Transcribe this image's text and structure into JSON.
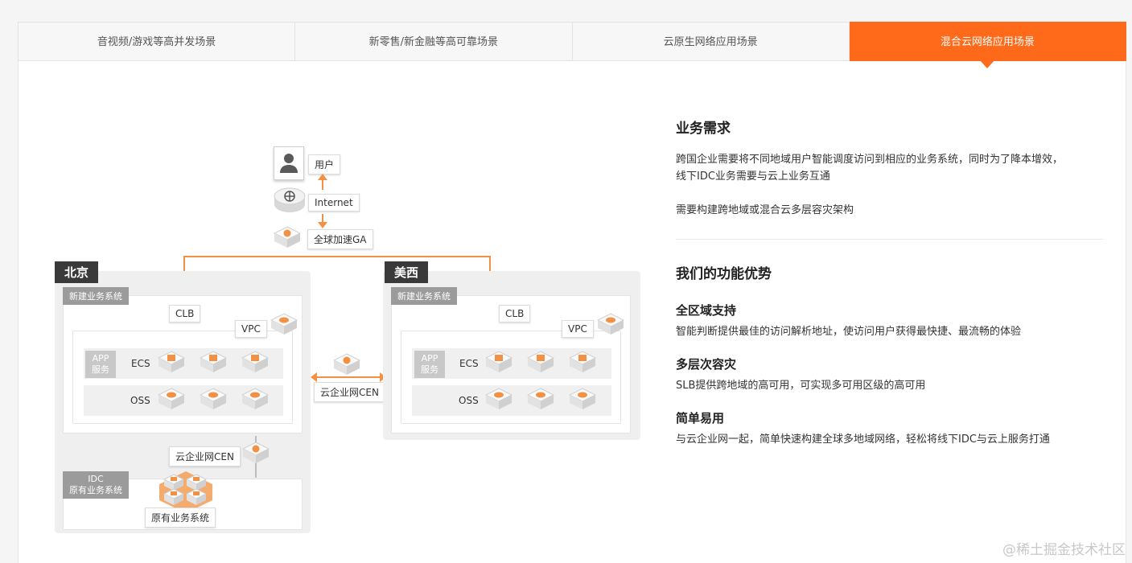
{
  "tabs": [
    {
      "label": "音视频/游戏等高并发场景",
      "active": false
    },
    {
      "label": "新零售/新金融等高可靠场景",
      "active": false
    },
    {
      "label": "云原生网络应用场景",
      "active": false
    },
    {
      "label": "混合云网络应用场景",
      "active": true
    }
  ],
  "accent": "#ff6a1a",
  "diagram": {
    "user": "用户",
    "internet": "Internet",
    "ga": "全球加速GA",
    "region_left": "北京",
    "region_right": "美西",
    "new_system": "新建业务系统",
    "clb": "CLB",
    "vpc": "VPC",
    "app_service_1": "APP",
    "app_service_2": "服务",
    "ecs": "ECS",
    "oss": "OSS",
    "cen": "云企业网CEN",
    "idc_1": "IDC",
    "idc_2": "原有业务系统",
    "legacy_system": "原有业务系统"
  },
  "right": {
    "needs_title": "业务需求",
    "needs_p1_line1": "跨国企业需要将不同地域用户智能调度访问到相应的业务系统，同时为了降本增效，",
    "needs_p1_line2": "线下IDC业务需要与云上业务互通",
    "needs_p2": "需要构建跨地域或混合云多层容灾架构",
    "advantages_title": "我们的功能优势",
    "features": [
      {
        "title": "全区域支持",
        "desc": "智能判断提供最佳的访问解析地址，使访问用户获得最快捷、最流畅的体验"
      },
      {
        "title": "多层次容灾",
        "desc": "SLB提供跨地域的高可用，可实现多可用区级的高可用"
      },
      {
        "title": "简单易用",
        "desc": "与云企业网一起，简单快速构建全球多地域网络，轻松将线下IDC与云上服务打通"
      }
    ]
  },
  "watermark": "@稀土掘金技术社区"
}
